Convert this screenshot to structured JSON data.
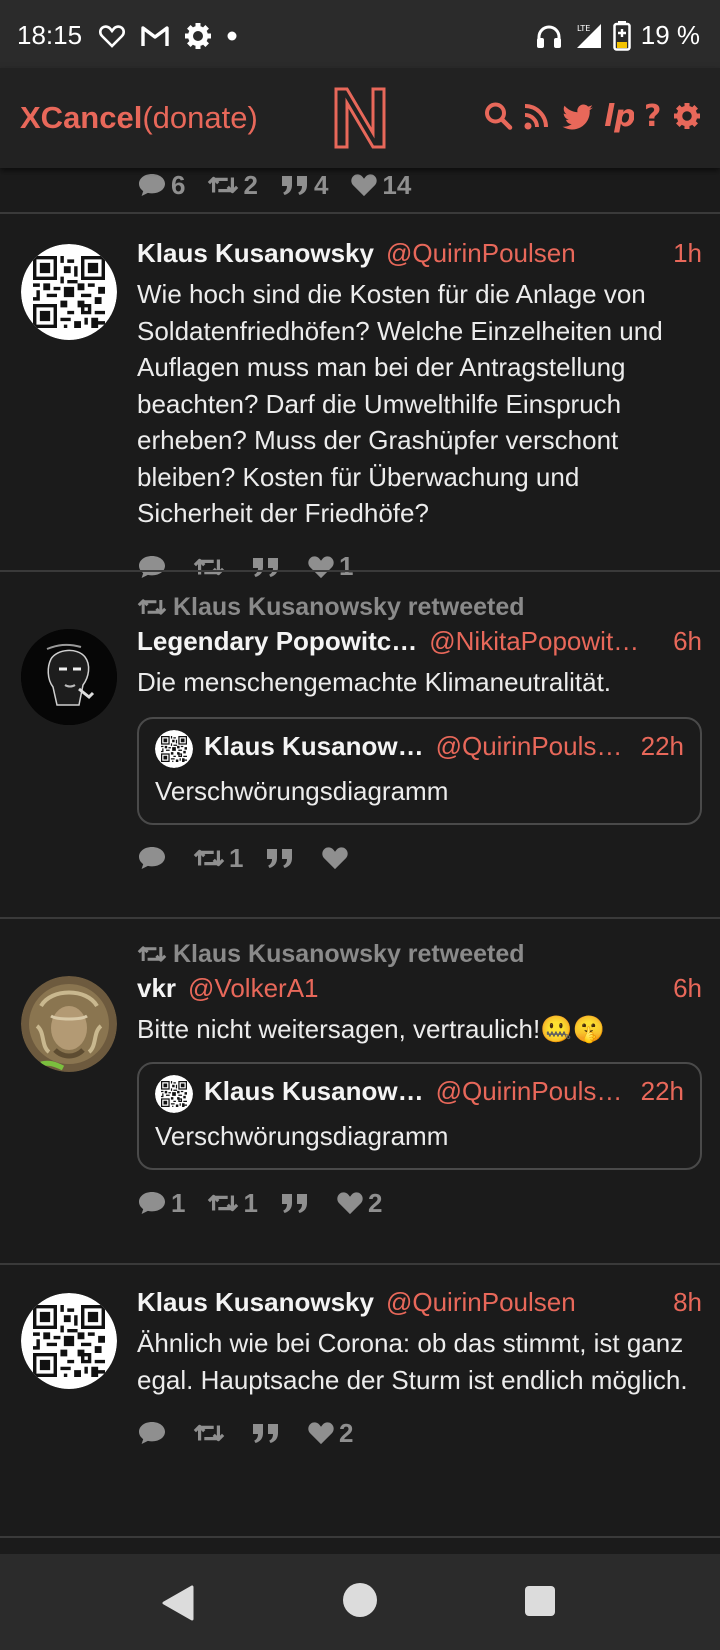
{
  "status_bar": {
    "time": "18:15",
    "battery": "19 %",
    "network": "LTE",
    "icons": [
      "heart-icon",
      "gmail-icon",
      "settings-icon",
      "dot-icon",
      "headphones-icon",
      "signal-icon",
      "battery-icon"
    ]
  },
  "header": {
    "brand": "XCancel",
    "donate": "(donate)",
    "logo_letter": "N",
    "accent": "#e8685a",
    "actions": [
      "search-icon",
      "rss-icon",
      "twitter-icon",
      "liberapay-icon",
      "help-icon",
      "settings-icon"
    ]
  },
  "prev_tweet_stats": {
    "replies": "6",
    "retweets": "2",
    "quotes": "4",
    "likes": "14"
  },
  "tweets": [
    {
      "name": "Klaus Kusanowsky",
      "handle": "@QuirinPoulsen",
      "time": "1h",
      "text": "Wie hoch sind die Kosten für die Anlage von Soldatenfriedhöfen? Welche Einzelheiten und Auflagen muss man bei der Antragstellung beachten? Darf die Umwelthilfe Einspruch erheben? Muss der Grashüpfer verschont bleiben? Kosten für Überwachung und Sicherheit der Friedhöfe?",
      "stats": {
        "replies": "",
        "retweets": "",
        "quotes": "",
        "likes": "1"
      }
    },
    {
      "retweeted_by": "Klaus Kusanowsky retweeted",
      "name": "Legendary Popowitc…",
      "handle": "@NikitaPopowit…",
      "time": "6h",
      "text": "Die menschengemachte Klimaneutralität.",
      "quote": {
        "name": "Klaus Kusanow…",
        "handle": "@QuirinPouls…",
        "time": "22h",
        "text": "Verschwörungsdiagramm"
      },
      "stats": {
        "replies": "",
        "retweets": "1",
        "quotes": "",
        "likes": ""
      }
    },
    {
      "retweeted_by": "Klaus Kusanowsky retweeted",
      "name": "vkr",
      "handle": "@VolkerA1",
      "time": "6h",
      "text": "Bitte nicht weitersagen, vertraulich!🤐🤫",
      "quote": {
        "name": "Klaus Kusanow…",
        "handle": "@QuirinPouls…",
        "time": "22h",
        "text": "Verschwörungsdiagramm"
      },
      "stats": {
        "replies": "1",
        "retweets": "1",
        "quotes": "",
        "likes": "2"
      }
    },
    {
      "name": "Klaus Kusanowsky",
      "handle": "@QuirinPoulsen",
      "time": "8h",
      "text": "Ähnlich wie bei Corona: ob das stimmt, ist ganz egal. Hauptsache der Sturm ist endlich möglich.",
      "stats": {
        "replies": "",
        "retweets": "",
        "quotes": "",
        "likes": "2"
      }
    }
  ],
  "nav": [
    "back-icon",
    "home-icon",
    "recents-icon"
  ]
}
